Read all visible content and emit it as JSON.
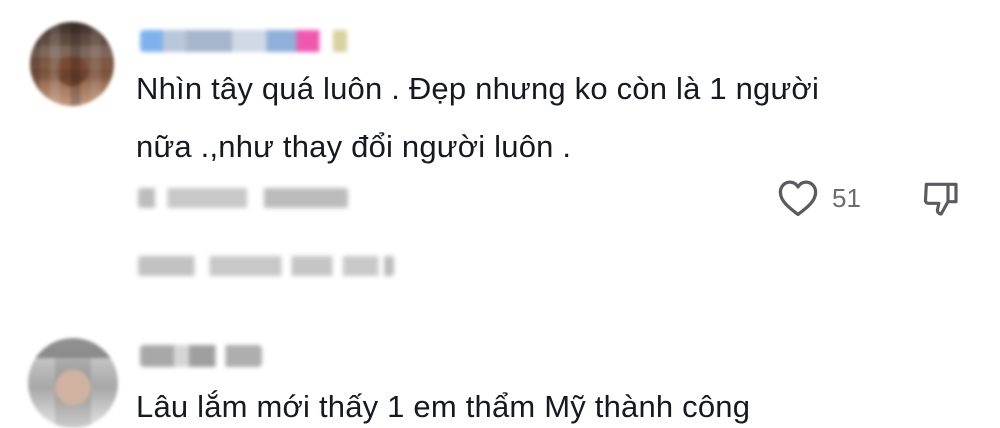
{
  "comments": [
    {
      "avatar": "blurred-user-avatar",
      "username": "",
      "text_line1": "Nhìn tây quá luôn . Đẹp nhưng ko còn là 1 người",
      "text_line2": "nữa .,như thay đổi người luôn .",
      "like_count": "51",
      "like_icon": "heart-outline-icon",
      "dislike_icon": "thumbs-down-icon"
    },
    {
      "avatar": "blurred-user-avatar",
      "username": "",
      "text_line1": "Lâu lắm mới thấy 1 em thẩm Mỹ thành công"
    }
  ],
  "colors": {
    "text": "#161823",
    "meta": "#6b6b70",
    "icon": "#5a5a60",
    "background": "#ffffff"
  }
}
